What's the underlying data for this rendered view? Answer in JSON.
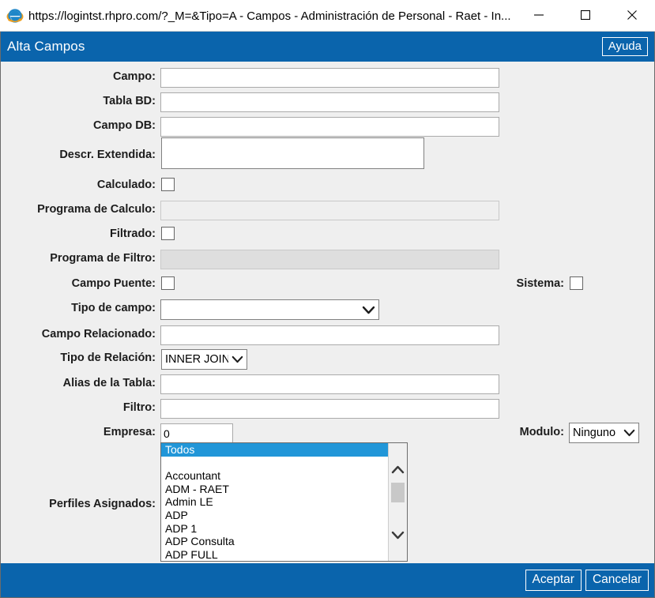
{
  "window": {
    "browser_title": "https://logintst.rhpro.com/?_M=&Tipo=A - Campos - Administración de Personal - Raet - In...",
    "minimize_label": "Minimizar",
    "maximize_label": "Maximizar",
    "close_label": "Cerrar"
  },
  "header": {
    "title": "Alta Campos",
    "help_label": "Ayuda",
    "bar_color": "#0a64ac"
  },
  "form": {
    "campo": {
      "label": "Campo:",
      "value": ""
    },
    "tabla_bd": {
      "label": "Tabla BD:",
      "value": ""
    },
    "campo_db": {
      "label": "Campo DB:",
      "value": ""
    },
    "descr_extendida": {
      "label": "Descr. Extendida:",
      "value": ""
    },
    "calculado": {
      "label": "Calculado:",
      "checked": false
    },
    "programa_calculo": {
      "label": "Programa de Calculo:",
      "value": ""
    },
    "filtrado": {
      "label": "Filtrado:",
      "checked": false
    },
    "programa_filtro": {
      "label": "Programa de Filtro:",
      "value": ""
    },
    "campo_puente": {
      "label": "Campo Puente:",
      "checked": false
    },
    "sistema": {
      "label": "Sistema:",
      "checked": false
    },
    "tipo_de_campo": {
      "label": "Tipo de campo:",
      "value": ""
    },
    "campo_relacionado": {
      "label": "Campo Relacionado:",
      "value": ""
    },
    "tipo_de_relacion": {
      "label": "Tipo de Relación:",
      "value": "INNER JOIN"
    },
    "alias_tabla": {
      "label": "Alias de la Tabla:",
      "value": ""
    },
    "filtro": {
      "label": "Filtro:",
      "value": ""
    },
    "empresa": {
      "label": "Empresa:",
      "value": "0"
    },
    "modulo": {
      "label": "Modulo:",
      "value": "Ninguno"
    },
    "perfiles": {
      "label": "Perfiles Asignados:",
      "selected": "Todos",
      "items": [
        "Todos",
        "",
        "Accountant",
        "ADM - RAET",
        "Admin LE",
        "ADP",
        "ADP 1",
        "ADP Consulta",
        "ADP FULL"
      ],
      "highlight_color": "#2196d8"
    }
  },
  "footer": {
    "accept_label": "Aceptar",
    "cancel_label": "Cancelar"
  }
}
